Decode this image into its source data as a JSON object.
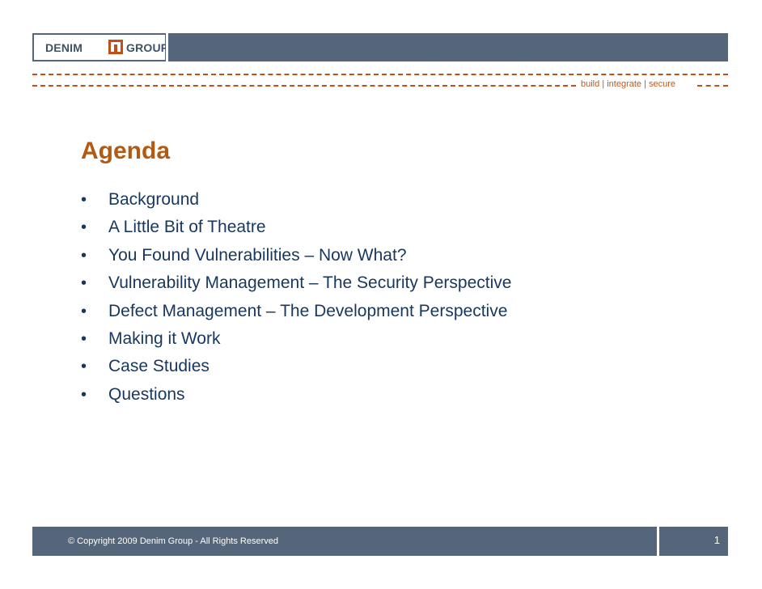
{
  "header": {
    "logo_left": "DENIM",
    "logo_right": "GROUP",
    "tagline": "build  |  integrate  |  secure"
  },
  "slide": {
    "title": "Agenda",
    "items": [
      "Background",
      "A Little Bit of Theatre",
      "You Found Vulnerabilities – Now What?",
      "Vulnerability Management – The Security Perspective",
      "Defect Management – The Development Perspective",
      "Making it Work",
      "Case Studies",
      "Questions"
    ]
  },
  "footer": {
    "copyright": "© Copyright 2009 Denim Group - All Rights Reserved",
    "page_number": "1"
  },
  "colors": {
    "header_bar": "#56667a",
    "accent_orange": "#c0501a",
    "title": "#b35a12",
    "body_text": "#17375e"
  }
}
